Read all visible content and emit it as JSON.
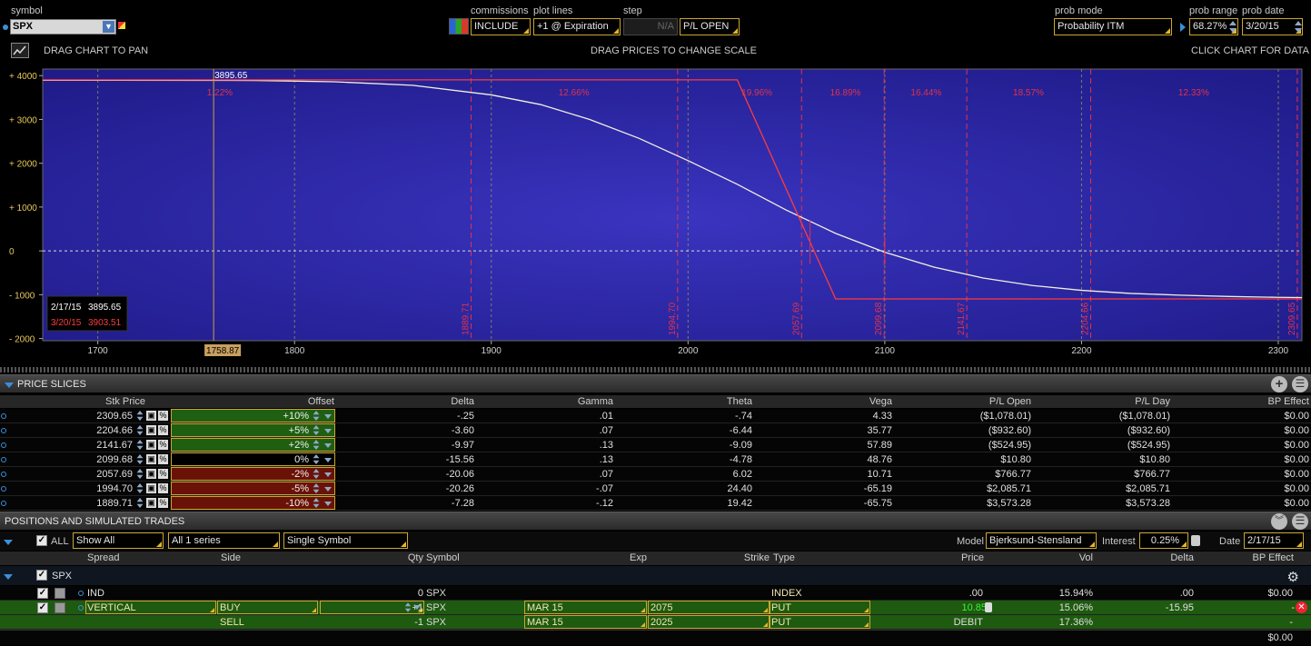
{
  "top": {
    "symbol_label": "symbol",
    "symbol_value": "SPX",
    "commissions_label": "commissions",
    "commissions_value": "INCLUDE",
    "plot_lines_label": "plot lines",
    "plot_lines_value": "+1 @ Expiration",
    "step_label": "step",
    "step_value": "N/A",
    "pl_mode": "P/L OPEN",
    "prob_mode_label": "prob mode",
    "prob_mode_value": "Probability ITM",
    "prob_range_label": "prob range",
    "prob_range_value": "68.27%",
    "prob_date_label": "prob date",
    "prob_date_value": "3/20/15",
    "hint_pan": "DRAG CHART TO PAN",
    "hint_scale": "DRAG PRICES TO CHANGE SCALE",
    "hint_data": "CLICK CHART FOR DATA"
  },
  "chart_data": {
    "type": "line",
    "x_ticks": [
      "1700",
      "1800",
      "1900",
      "2000",
      "2100",
      "2200",
      "2300"
    ],
    "y_ticks": [
      "+ 4000",
      "+ 3000",
      "+ 2000",
      "+ 1000",
      "0",
      "- 1000",
      "- 2000"
    ],
    "xlim": [
      1672,
      2312
    ],
    "ylim": [
      -2050,
      4150
    ],
    "current_price_label": "3895.65",
    "cursor_price_label": "1758.87",
    "cursor_price": 1758.87,
    "slice_prices": [
      1889.71,
      1994.7,
      2057.69,
      2099.68,
      2141.67,
      2204.66,
      2309.65
    ],
    "slice_labels": [
      "1889.71",
      "1994.70",
      "2057.69",
      "2099.68",
      "2141.67",
      "2204.66",
      "2309.65"
    ],
    "prob_pcts": [
      "1.22%",
      "12.66%",
      "19.96%",
      "16.89%",
      "16.44%",
      "18.57%",
      "12.33%"
    ],
    "prob_x": [
      1762,
      1942,
      2035,
      2080,
      2121,
      2173,
      2257
    ],
    "legend": [
      {
        "date": "2/17/15",
        "value": "3895.65",
        "color": "#ffffff"
      },
      {
        "date": "3/20/15",
        "value": "3903.51",
        "color": "#ff3b3b"
      }
    ],
    "series": [
      {
        "name": "2/17/15",
        "color": "#f0f0e0",
        "x": [
          1672,
          1700,
          1780,
          1820,
          1860,
          1900,
          1925,
          1950,
          1975,
          2000,
          2025,
          2050,
          2075,
          2100,
          2125,
          2150,
          2175,
          2200,
          2225,
          2250,
          2275,
          2300,
          2312
        ],
        "y": [
          3895,
          3895,
          3890,
          3860,
          3780,
          3560,
          3340,
          3000,
          2570,
          2060,
          1520,
          930,
          400,
          -30,
          -370,
          -620,
          -790,
          -900,
          -970,
          -1010,
          -1040,
          -1060,
          -1065
        ]
      },
      {
        "name": "3/20/15",
        "color": "#ff3b3b",
        "x": [
          1672,
          2025,
          2075,
          2312
        ],
        "y": [
          3903.51,
          3903.51,
          -1096.49,
          -1096.49
        ]
      }
    ]
  },
  "price_slices": {
    "title": "PRICE SLICES",
    "headers": [
      "Stk Price",
      "Offset",
      "Delta",
      "Gamma",
      "Theta",
      "Vega",
      "P/L Open",
      "P/L Day",
      "BP Effect"
    ],
    "rows": [
      {
        "stk": "2309.65",
        "offset": "+10%",
        "delta": "-.25",
        "gamma": ".01",
        "theta": "-.74",
        "vega": "4.33",
        "pl_open": "($1,078.01)",
        "pl_day": "($1,078.01)",
        "bp": "$0.00",
        "color": "#1f5f12"
      },
      {
        "stk": "2204.66",
        "offset": "+5%",
        "delta": "-3.60",
        "gamma": ".07",
        "theta": "-6.44",
        "vega": "35.77",
        "pl_open": "($932.60)",
        "pl_day": "($932.60)",
        "bp": "$0.00",
        "color": "#1f5f12"
      },
      {
        "stk": "2141.67",
        "offset": "+2%",
        "delta": "-9.97",
        "gamma": ".13",
        "theta": "-9.09",
        "vega": "57.89",
        "pl_open": "($524.95)",
        "pl_day": "($524.95)",
        "bp": "$0.00",
        "color": "#1f5f12"
      },
      {
        "stk": "2099.68",
        "offset": "0%",
        "delta": "-15.56",
        "gamma": ".13",
        "theta": "-4.78",
        "vega": "48.76",
        "pl_open": "$10.80",
        "pl_day": "$10.80",
        "bp": "$0.00",
        "color": "#000000"
      },
      {
        "stk": "2057.69",
        "offset": "-2%",
        "delta": "-20.06",
        "gamma": ".07",
        "theta": "6.02",
        "vega": "10.71",
        "pl_open": "$766.77",
        "pl_day": "$766.77",
        "bp": "$0.00",
        "color": "#6a1208"
      },
      {
        "stk": "1994.70",
        "offset": "-5%",
        "delta": "-20.26",
        "gamma": "-.07",
        "theta": "24.40",
        "vega": "-65.19",
        "pl_open": "$2,085.71",
        "pl_day": "$2,085.71",
        "bp": "$0.00",
        "color": "#6a1208"
      },
      {
        "stk": "1889.71",
        "offset": "-10%",
        "delta": "-7.28",
        "gamma": "-.12",
        "theta": "19.42",
        "vega": "-65.75",
        "pl_open": "$3,573.28",
        "pl_day": "$3,573.28",
        "bp": "$0.00",
        "color": "#6a1208"
      }
    ]
  },
  "positions": {
    "title": "POSITIONS AND SIMULATED TRADES",
    "all_label": "ALL",
    "filter_show": "Show All",
    "filter_series": "All 1 series",
    "filter_symbol": "Single Symbol",
    "model_label": "Model",
    "model_value": "Bjerksund-Stensland",
    "interest_label": "Interest",
    "interest_value": "0.25%",
    "date_label": "Date",
    "date_value": "2/17/15",
    "headers": [
      "Spread",
      "Side",
      "Qty",
      "Symbol",
      "Exp",
      "Strike",
      "Type",
      "Price",
      "Vol",
      "Delta",
      "BP Effect"
    ],
    "group_label": "SPX",
    "rows": [
      {
        "spread": "IND",
        "side": "",
        "qty": "0",
        "symbol": "SPX",
        "exp": "",
        "strike": "",
        "type": "INDEX",
        "price": ".00",
        "vol": "15.94%",
        "delta": ".00",
        "bp": "$0.00"
      },
      {
        "spread": "VERTICAL",
        "side": "BUY",
        "qty": "+1",
        "symbol": "SPX",
        "exp": "MAR 15",
        "strike": "2075",
        "type": "PUT",
        "price": "10.85",
        "vol": "15.06%",
        "delta": "-15.95",
        "bp": "-"
      },
      {
        "spread": "",
        "side": "SELL",
        "qty": "-1",
        "symbol": "SPX",
        "exp": "MAR 15",
        "strike": "2025",
        "type": "PUT",
        "price": "DEBIT",
        "vol": "17.36%",
        "delta": "",
        "bp": "-"
      }
    ],
    "total_bp": "$0.00"
  }
}
